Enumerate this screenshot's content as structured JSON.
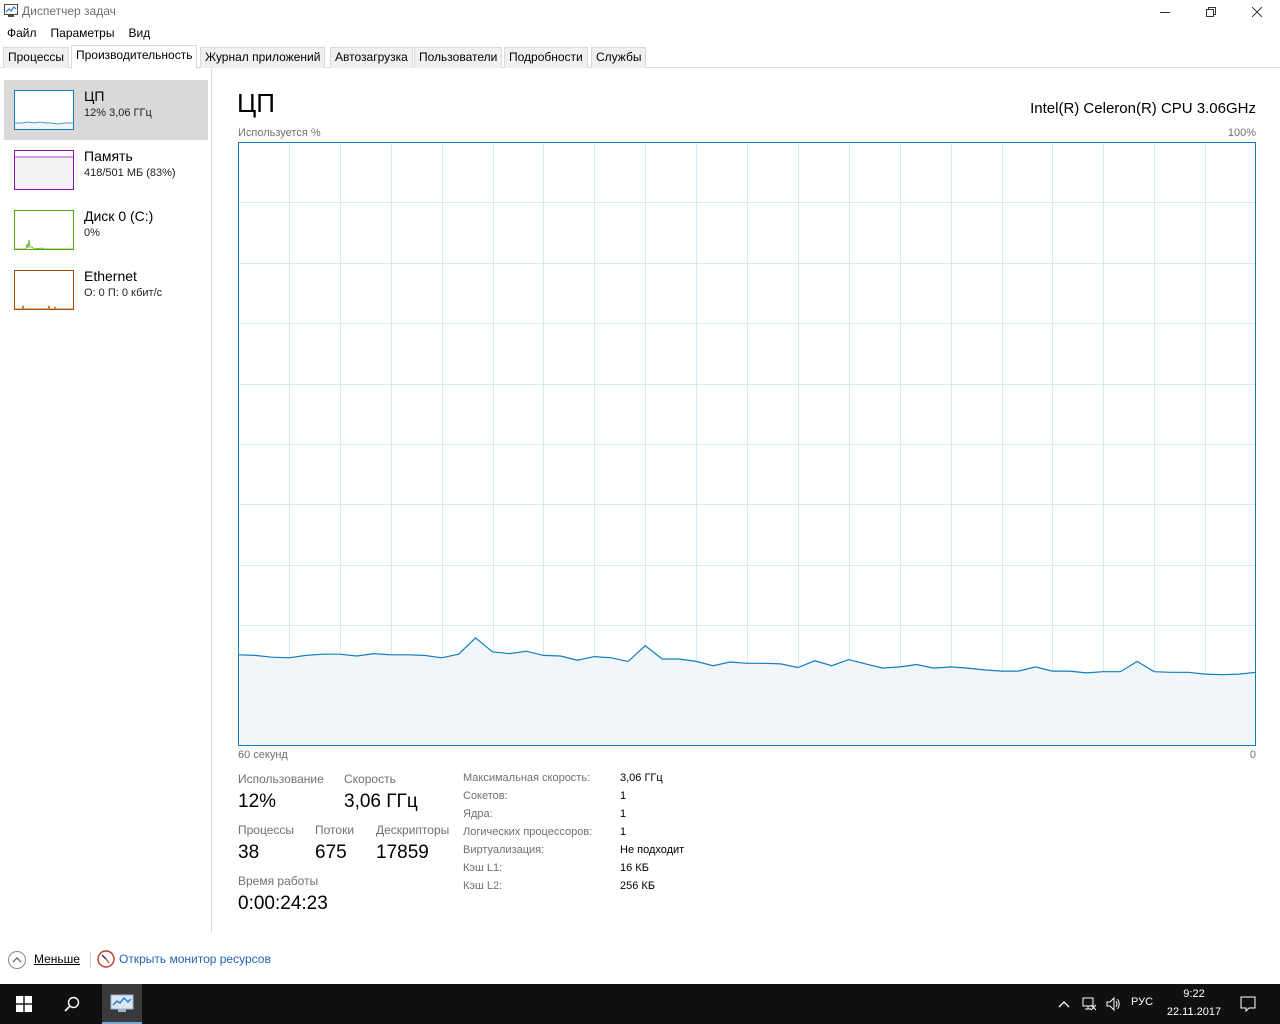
{
  "window": {
    "title": "Диспетчер задач",
    "controls": [
      "minimize-icon",
      "restore-icon",
      "close-icon"
    ]
  },
  "menu": [
    "Файл",
    "Параметры",
    "Вид"
  ],
  "tabs": [
    {
      "label": "Процессы"
    },
    {
      "label": "Производительность",
      "active": true
    },
    {
      "label": "Журнал приложений"
    },
    {
      "label": "Автозагрузка"
    },
    {
      "label": "Пользователи"
    },
    {
      "label": "Подробности"
    },
    {
      "label": "Службы"
    }
  ],
  "sidebar": {
    "items": [
      {
        "title": "ЦП",
        "subtitle": "12% 3,06 ГГц",
        "color": "#117dbb",
        "fill": "#f1f6fa",
        "active": true
      },
      {
        "title": "Память",
        "subtitle": "418/501 МБ (83%)",
        "color": "#8b12ae",
        "fill": "#f4f2f4"
      },
      {
        "title": "Диск 0 (C:)",
        "subtitle": "0%",
        "color": "#4da60c",
        "fill": "#ffffff"
      },
      {
        "title": "Ethernet",
        "subtitle": "О: 0 П: 0 кбит/с",
        "color": "#a74f01",
        "fill": "#ffffff"
      }
    ]
  },
  "main": {
    "title": "ЦП",
    "cpu_model": "Intel(R) Celeron(R) CPU 3.06GHz",
    "y_axis_label": "Используется %",
    "y_axis_max": "100%",
    "x_axis_left": "60 секунд",
    "x_axis_right": "0"
  },
  "chart_data": {
    "type": "area",
    "color": "#117dbb",
    "fill": "#f1f6fa",
    "grid": true,
    "ylim": [
      0,
      100
    ],
    "xlim": [
      60,
      0
    ],
    "x": [
      60,
      59,
      58,
      57,
      56,
      55,
      54,
      53,
      52,
      51,
      50,
      49,
      48,
      47,
      46,
      45,
      44,
      43,
      42,
      41,
      40,
      39,
      38,
      37,
      36,
      35,
      34,
      33,
      32,
      31,
      30,
      29,
      28,
      27,
      26,
      25,
      24,
      23,
      22,
      21,
      20,
      19,
      18,
      17,
      16,
      15,
      14,
      13,
      12,
      11,
      10,
      9,
      8,
      7,
      6,
      5,
      4,
      3,
      2,
      1,
      0
    ],
    "values": [
      15.1,
      15.0,
      14.7,
      14.6,
      15.0,
      15.2,
      15.2,
      14.9,
      15.3,
      15.1,
      15.1,
      15.0,
      14.6,
      15.2,
      17.9,
      15.6,
      15.3,
      15.7,
      15.0,
      14.9,
      14.2,
      14.8,
      14.6,
      14.0,
      16.6,
      14.4,
      14.4,
      14.0,
      13.3,
      13.9,
      13.7,
      13.7,
      13.6,
      13.0,
      14.1,
      13.3,
      14.3,
      13.6,
      12.9,
      13.1,
      13.5,
      12.9,
      13.1,
      12.9,
      12.6,
      12.4,
      12.4,
      13.1,
      12.4,
      12.4,
      12.1,
      12.3,
      12.3,
      14.0,
      12.3,
      12.2,
      12.2,
      11.9,
      11.8,
      11.9,
      12.2
    ]
  },
  "stats": {
    "utilization": {
      "label": "Использование",
      "value": "12%"
    },
    "speed": {
      "label": "Скорость",
      "value": "3,06 ГГц"
    },
    "processes": {
      "label": "Процессы",
      "value": "38"
    },
    "threads": {
      "label": "Потоки",
      "value": "675"
    },
    "handles": {
      "label": "Дескрипторы",
      "value": "17859"
    },
    "uptime": {
      "label": "Время работы",
      "value": "0:00:24:23"
    }
  },
  "info": [
    {
      "label": "Максимальная скорость:",
      "value": "3,06 ГГц"
    },
    {
      "label": "Сокетов:",
      "value": "1"
    },
    {
      "label": "Ядра:",
      "value": "1"
    },
    {
      "label": "Логических процессоров:",
      "value": "1"
    },
    {
      "label": "Виртуализация:",
      "value": "Не подходит"
    },
    {
      "label": "Кэш L1:",
      "value": "16 КБ"
    },
    {
      "label": "Кэш L2:",
      "value": "256 КБ"
    }
  ],
  "footer": {
    "less_label": "Меньше",
    "resource_monitor_label": "Открыть монитор ресурсов"
  },
  "taskbar": {
    "language": "РУС",
    "time": "9:22",
    "date": "22.11.2017"
  }
}
